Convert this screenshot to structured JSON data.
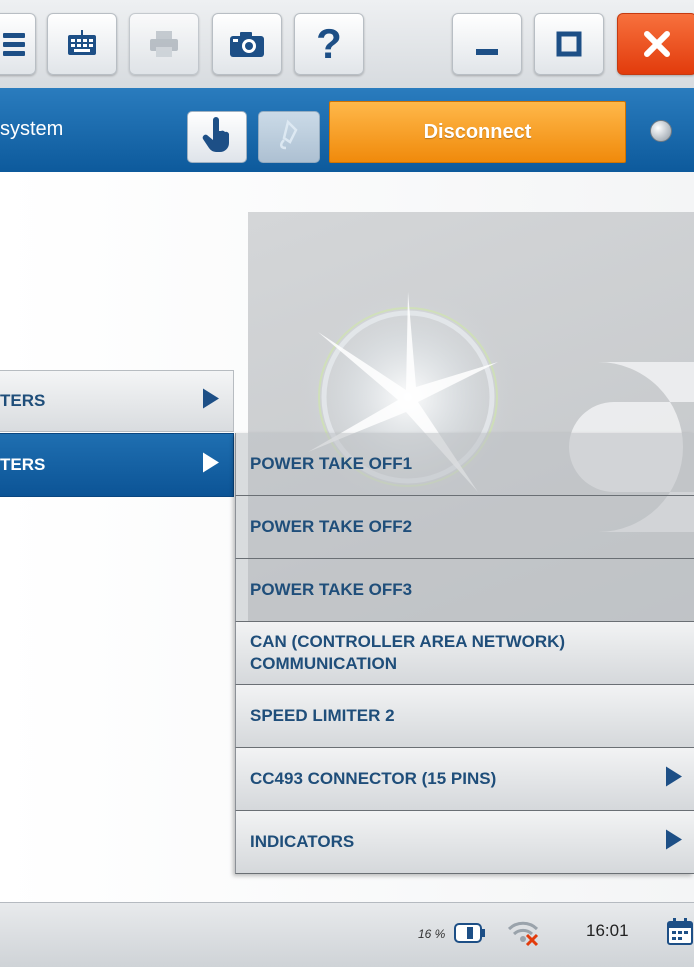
{
  "toolbar": {
    "buttons": [
      {
        "icon": "menu-icon"
      },
      {
        "icon": "keyboard-icon"
      },
      {
        "icon": "printer-icon"
      },
      {
        "icon": "camera-icon"
      },
      {
        "icon": "help-icon",
        "glyph": "?"
      },
      {
        "icon": "minimize-icon"
      },
      {
        "icon": "maximize-icon"
      },
      {
        "icon": "close-icon"
      }
    ]
  },
  "titlebar": {
    "title": "system",
    "disconnect_label": "Disconnect",
    "hand_icon": "hand-pointer-icon",
    "pen_icon": "pen-icon",
    "status_led": "status-led-icon"
  },
  "menu": {
    "level1": [
      {
        "label": "TERS",
        "active": false
      },
      {
        "label": "TERS",
        "active": true
      }
    ],
    "submenu": [
      {
        "label": "POWER TAKE OFF1",
        "has_children": false
      },
      {
        "label": "POWER TAKE OFF2",
        "has_children": false
      },
      {
        "label": "POWER TAKE OFF3",
        "has_children": false
      },
      {
        "label": "CAN (CONTROLLER AREA NETWORK) COMMUNICATION",
        "has_children": false
      },
      {
        "label": "SPEED LIMITER 2",
        "has_children": false
      },
      {
        "label": "CC493 CONNECTOR (15 PINS)",
        "has_children": true
      },
      {
        "label": "INDICATORS",
        "has_children": true
      }
    ]
  },
  "statusbar": {
    "battery": "16 %",
    "time": "16:01",
    "battery_icon": "battery-icon",
    "network_icon": "network-disconnected-icon",
    "calendar_icon": "calendar-icon"
  },
  "colors": {
    "accent_blue": "#0d5a9c",
    "disconnect_orange": "#f08a0b",
    "menu_text": "#1f4e7a",
    "close_red": "#e23b0c"
  }
}
